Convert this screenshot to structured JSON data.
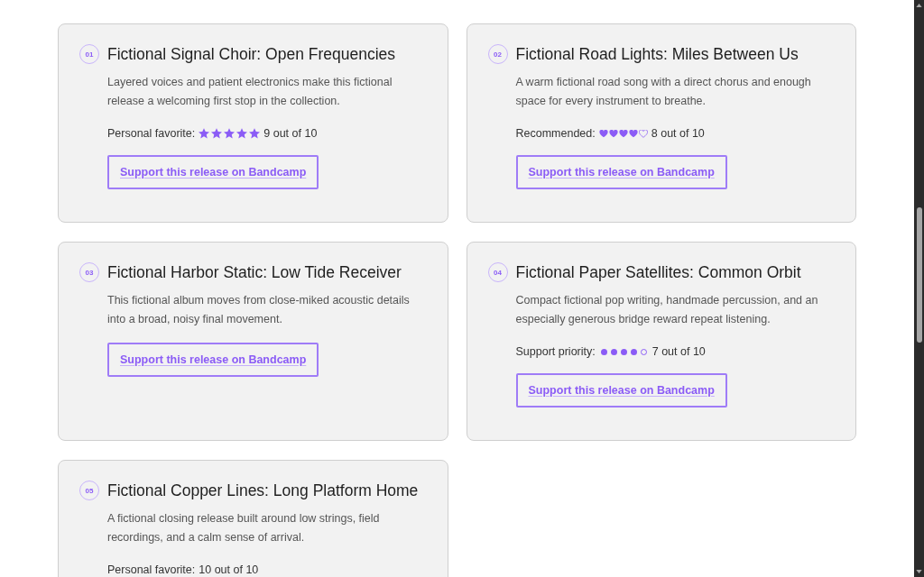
{
  "releases": [
    {
      "number": "01",
      "title": "Fictional Signal Choir: Open Frequencies",
      "description": "Layered voices and patient electronics make this fictional release a welcoming first stop in the collection.",
      "rating": {
        "kind": "stars",
        "label": "Personal favorite:",
        "stars": 5,
        "score": "9 out of 10"
      },
      "link": "Support this release on Bandcamp"
    },
    {
      "number": "02",
      "title": "Fictional Road Lights: Miles Between Us",
      "description": "A warm fictional road song with a direct chorus and enough space for every instrument to breathe.",
      "rating": {
        "kind": "hearts",
        "label": "Recommended:",
        "stars": 4,
        "score": "8 out of 10"
      },
      "link": "Support this release on Bandcamp"
    },
    {
      "number": "03",
      "title": "Fictional Harbor Static: Low Tide Receiver",
      "description": "This fictional album moves from close-miked acoustic details into a broad, noisy final movement.",
      "link": "Support this release on Bandcamp"
    },
    {
      "number": "04",
      "title": "Fictional Paper Satellites: Common Orbit",
      "description": "Compact fictional pop writing, handmade percussion, and an especially generous bridge reward repeat listening.",
      "rating": {
        "kind": "dots",
        "label": "Support priority:",
        "stars": 4,
        "score": "7 out of 10"
      },
      "link": "Support this release on Bandcamp"
    },
    {
      "number": "05",
      "title": "Fictional Copper Lines: Long Platform Home",
      "description": "A fictional closing release built around low strings, field recordings, and a calm sense of arrival.",
      "rating": {
        "kind": "plain",
        "label": "Personal favorite:",
        "score": "10 out of 10"
      }
    }
  ]
}
